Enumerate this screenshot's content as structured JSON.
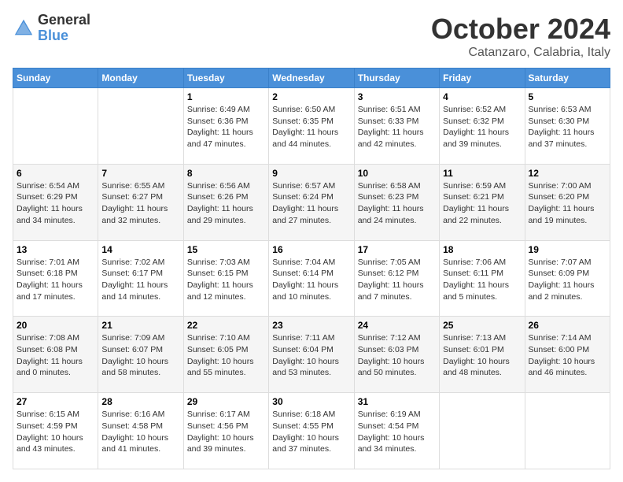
{
  "logo": {
    "general": "General",
    "blue": "Blue"
  },
  "title": "October 2024",
  "subtitle": "Catanzaro, Calabria, Italy",
  "days_of_week": [
    "Sunday",
    "Monday",
    "Tuesday",
    "Wednesday",
    "Thursday",
    "Friday",
    "Saturday"
  ],
  "weeks": [
    [
      {
        "day": "",
        "info": ""
      },
      {
        "day": "",
        "info": ""
      },
      {
        "day": "1",
        "info": "Sunrise: 6:49 AM\nSunset: 6:36 PM\nDaylight: 11 hours and 47 minutes."
      },
      {
        "day": "2",
        "info": "Sunrise: 6:50 AM\nSunset: 6:35 PM\nDaylight: 11 hours and 44 minutes."
      },
      {
        "day": "3",
        "info": "Sunrise: 6:51 AM\nSunset: 6:33 PM\nDaylight: 11 hours and 42 minutes."
      },
      {
        "day": "4",
        "info": "Sunrise: 6:52 AM\nSunset: 6:32 PM\nDaylight: 11 hours and 39 minutes."
      },
      {
        "day": "5",
        "info": "Sunrise: 6:53 AM\nSunset: 6:30 PM\nDaylight: 11 hours and 37 minutes."
      }
    ],
    [
      {
        "day": "6",
        "info": "Sunrise: 6:54 AM\nSunset: 6:29 PM\nDaylight: 11 hours and 34 minutes."
      },
      {
        "day": "7",
        "info": "Sunrise: 6:55 AM\nSunset: 6:27 PM\nDaylight: 11 hours and 32 minutes."
      },
      {
        "day": "8",
        "info": "Sunrise: 6:56 AM\nSunset: 6:26 PM\nDaylight: 11 hours and 29 minutes."
      },
      {
        "day": "9",
        "info": "Sunrise: 6:57 AM\nSunset: 6:24 PM\nDaylight: 11 hours and 27 minutes."
      },
      {
        "day": "10",
        "info": "Sunrise: 6:58 AM\nSunset: 6:23 PM\nDaylight: 11 hours and 24 minutes."
      },
      {
        "day": "11",
        "info": "Sunrise: 6:59 AM\nSunset: 6:21 PM\nDaylight: 11 hours and 22 minutes."
      },
      {
        "day": "12",
        "info": "Sunrise: 7:00 AM\nSunset: 6:20 PM\nDaylight: 11 hours and 19 minutes."
      }
    ],
    [
      {
        "day": "13",
        "info": "Sunrise: 7:01 AM\nSunset: 6:18 PM\nDaylight: 11 hours and 17 minutes."
      },
      {
        "day": "14",
        "info": "Sunrise: 7:02 AM\nSunset: 6:17 PM\nDaylight: 11 hours and 14 minutes."
      },
      {
        "day": "15",
        "info": "Sunrise: 7:03 AM\nSunset: 6:15 PM\nDaylight: 11 hours and 12 minutes."
      },
      {
        "day": "16",
        "info": "Sunrise: 7:04 AM\nSunset: 6:14 PM\nDaylight: 11 hours and 10 minutes."
      },
      {
        "day": "17",
        "info": "Sunrise: 7:05 AM\nSunset: 6:12 PM\nDaylight: 11 hours and 7 minutes."
      },
      {
        "day": "18",
        "info": "Sunrise: 7:06 AM\nSunset: 6:11 PM\nDaylight: 11 hours and 5 minutes."
      },
      {
        "day": "19",
        "info": "Sunrise: 7:07 AM\nSunset: 6:09 PM\nDaylight: 11 hours and 2 minutes."
      }
    ],
    [
      {
        "day": "20",
        "info": "Sunrise: 7:08 AM\nSunset: 6:08 PM\nDaylight: 11 hours and 0 minutes."
      },
      {
        "day": "21",
        "info": "Sunrise: 7:09 AM\nSunset: 6:07 PM\nDaylight: 10 hours and 58 minutes."
      },
      {
        "day": "22",
        "info": "Sunrise: 7:10 AM\nSunset: 6:05 PM\nDaylight: 10 hours and 55 minutes."
      },
      {
        "day": "23",
        "info": "Sunrise: 7:11 AM\nSunset: 6:04 PM\nDaylight: 10 hours and 53 minutes."
      },
      {
        "day": "24",
        "info": "Sunrise: 7:12 AM\nSunset: 6:03 PM\nDaylight: 10 hours and 50 minutes."
      },
      {
        "day": "25",
        "info": "Sunrise: 7:13 AM\nSunset: 6:01 PM\nDaylight: 10 hours and 48 minutes."
      },
      {
        "day": "26",
        "info": "Sunrise: 7:14 AM\nSunset: 6:00 PM\nDaylight: 10 hours and 46 minutes."
      }
    ],
    [
      {
        "day": "27",
        "info": "Sunrise: 6:15 AM\nSunset: 4:59 PM\nDaylight: 10 hours and 43 minutes."
      },
      {
        "day": "28",
        "info": "Sunrise: 6:16 AM\nSunset: 4:58 PM\nDaylight: 10 hours and 41 minutes."
      },
      {
        "day": "29",
        "info": "Sunrise: 6:17 AM\nSunset: 4:56 PM\nDaylight: 10 hours and 39 minutes."
      },
      {
        "day": "30",
        "info": "Sunrise: 6:18 AM\nSunset: 4:55 PM\nDaylight: 10 hours and 37 minutes."
      },
      {
        "day": "31",
        "info": "Sunrise: 6:19 AM\nSunset: 4:54 PM\nDaylight: 10 hours and 34 minutes."
      },
      {
        "day": "",
        "info": ""
      },
      {
        "day": "",
        "info": ""
      }
    ]
  ]
}
